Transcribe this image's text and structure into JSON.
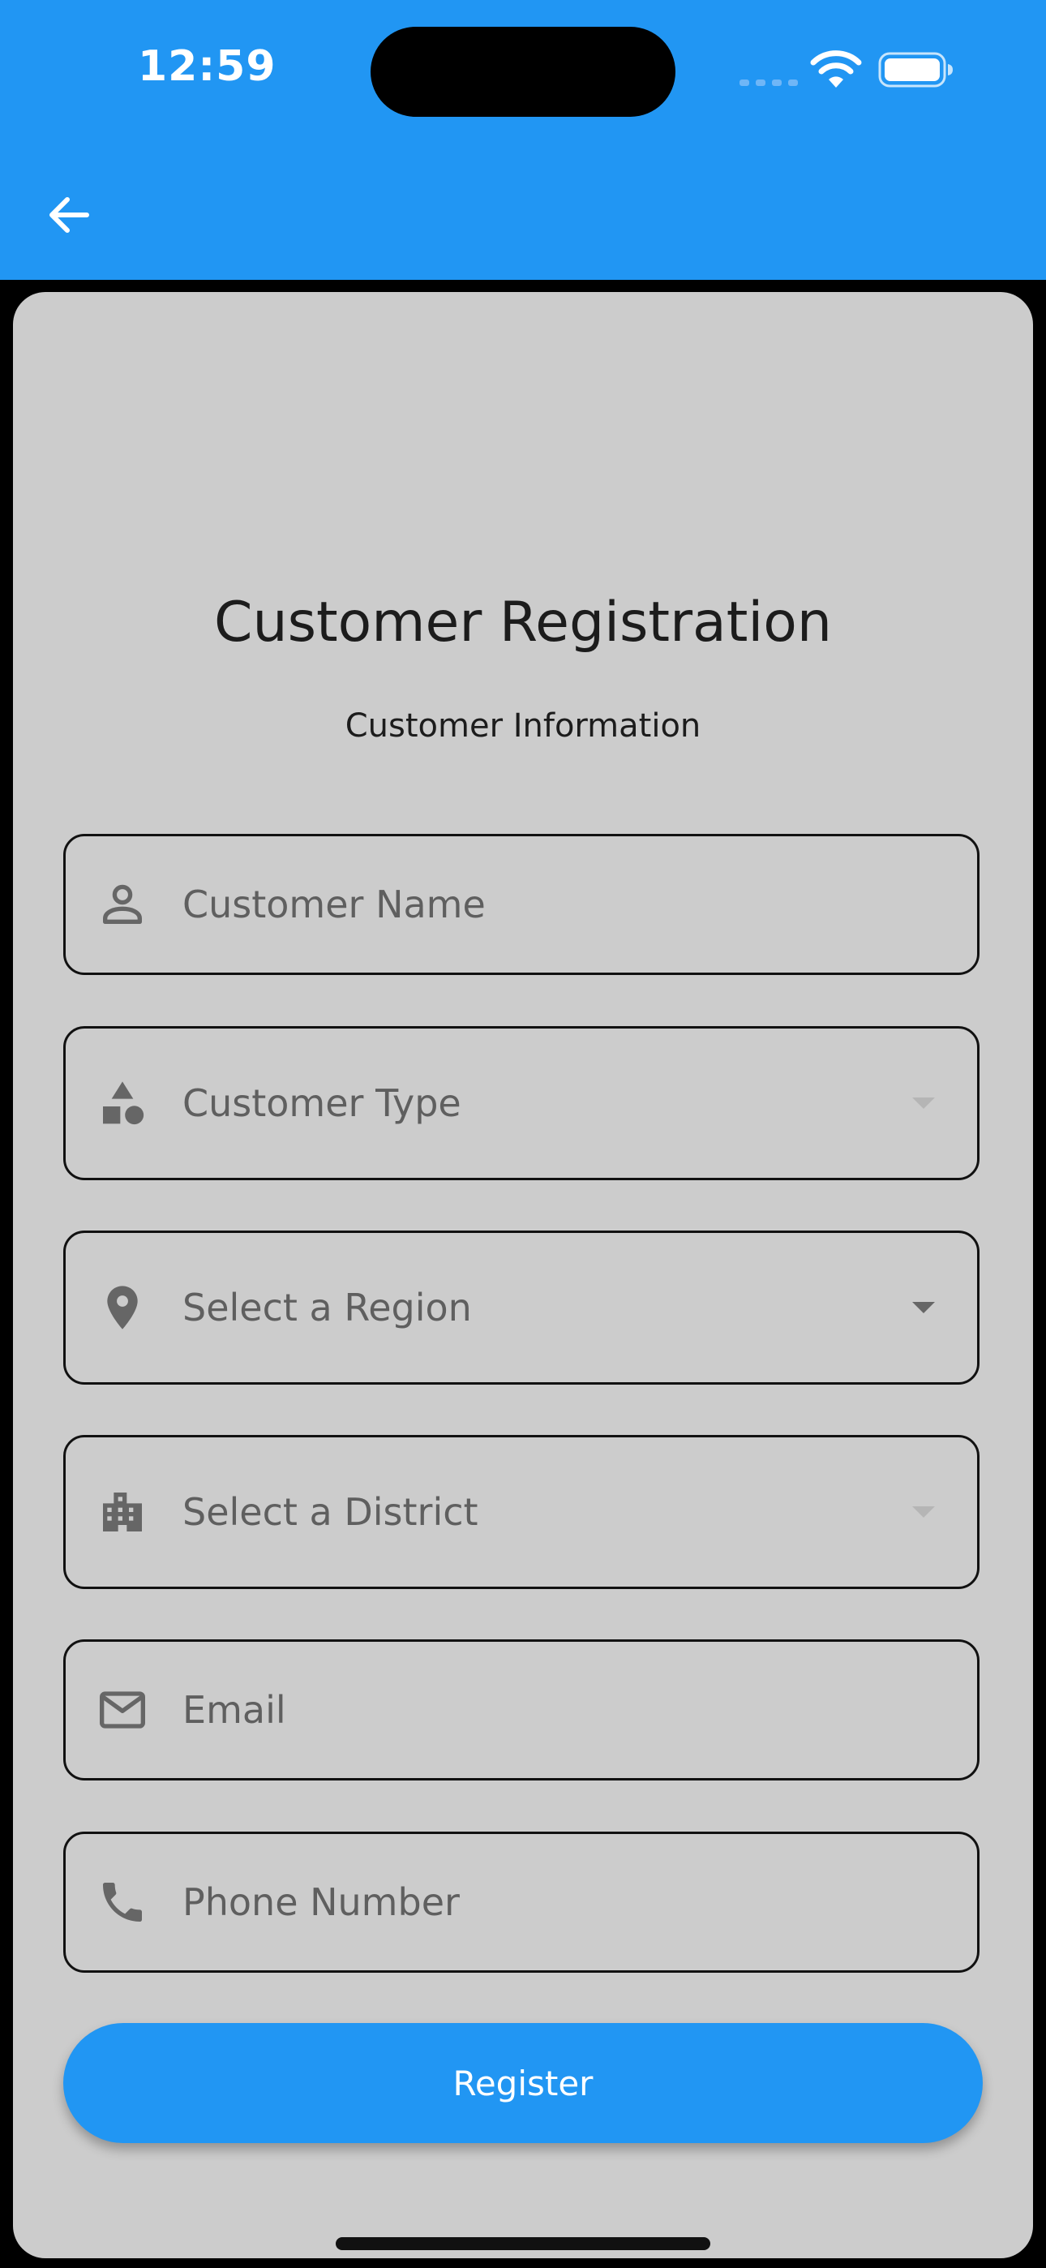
{
  "status_bar": {
    "time": "12:59"
  },
  "app_bar": {
    "back_icon": "arrow-back-icon",
    "color": "#2196F3"
  },
  "form": {
    "title": "Customer Registration",
    "subtitle": "Customer Information",
    "fields": [
      {
        "label": "Customer Name",
        "icon": "person-icon",
        "type": "text"
      },
      {
        "label": "Customer Type",
        "icon": "category-icon",
        "type": "dropdown",
        "enabled": false
      },
      {
        "label": "Select a Region",
        "icon": "location-pin-icon",
        "type": "dropdown",
        "enabled": true
      },
      {
        "label": "Select a District",
        "icon": "building-icon",
        "type": "dropdown",
        "enabled": false
      },
      {
        "label": "Email",
        "icon": "mail-icon",
        "type": "email"
      },
      {
        "label": "Phone Number",
        "icon": "phone-icon",
        "type": "tel"
      }
    ],
    "register_label": "Register"
  },
  "colors": {
    "accent": "#2196F3",
    "card_background": "#CCCCCC",
    "field_border": "#111111",
    "label_text": "#5F5F5F"
  }
}
